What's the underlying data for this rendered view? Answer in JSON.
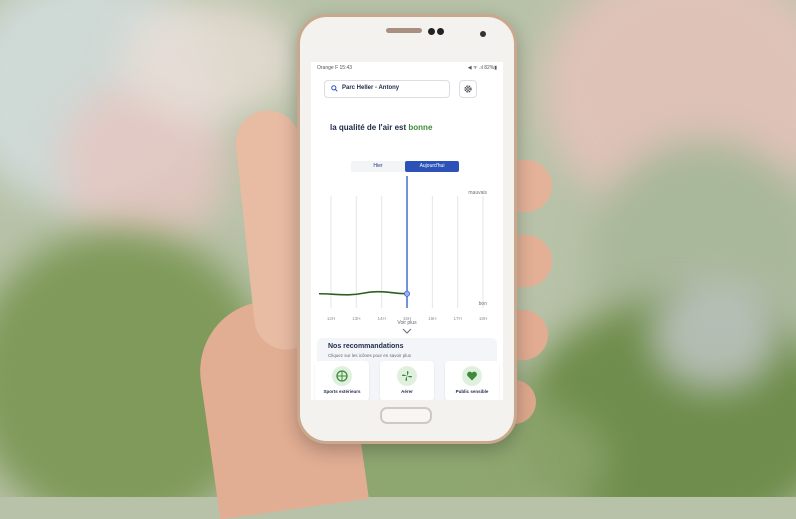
{
  "status_bar": {
    "carrier_time": "Orange F 15:43",
    "right": "◀ ᯤ .ıl 82%▮"
  },
  "location": {
    "label": "Parc Heller - Antony"
  },
  "headline": {
    "prefix": "la qualité de l'air est",
    "quality": "bonne"
  },
  "toggle": {
    "options": [
      "Hier",
      "Aujourd'hui"
    ],
    "selected": "Aujourd'hui"
  },
  "chart_data": {
    "type": "line",
    "x": [
      "12H",
      "13H",
      "14H",
      "15H",
      "16H",
      "17H",
      "18H"
    ],
    "values": [
      0.06,
      0.05,
      0.08,
      0.06
    ],
    "label_top": "mauvais",
    "label_bottom": "bon",
    "current_time": "15H",
    "line_color": "#2f5e22",
    "cursor_color": "#3a63c8"
  },
  "more": {
    "label": "Voir plus"
  },
  "recommendations": {
    "title": "Nos recommandations",
    "subtitle": "Cliquez sur les icônes pour en savoir plus",
    "items": [
      {
        "label": "Sports extérieurs",
        "icon": "ball-icon"
      },
      {
        "label": "Aérer",
        "icon": "fan-icon"
      },
      {
        "label": "Public sensible",
        "icon": "heart-icon"
      }
    ]
  },
  "colors": {
    "accent": "#2c52b8",
    "good": "#3f8a3a",
    "text": "#1d2a4a"
  }
}
